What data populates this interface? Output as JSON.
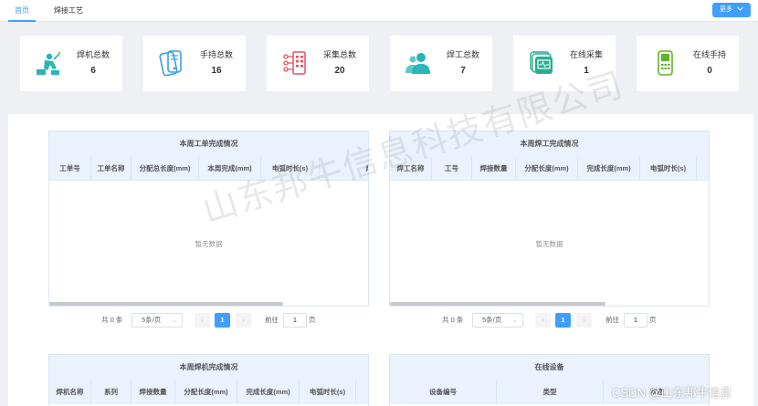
{
  "tabs": [
    {
      "label": "首页"
    },
    {
      "label": "焊接工艺"
    }
  ],
  "more_button": {
    "label": "更多",
    "icon": "chevron-down-icon"
  },
  "stats": [
    {
      "label": "焊机总数",
      "value": "6",
      "icon": "welder-icon",
      "color": "#2bb5b5"
    },
    {
      "label": "手持总数",
      "value": "16",
      "icon": "handheld-icon",
      "color": "#3aa0e0"
    },
    {
      "label": "采集总数",
      "value": "20",
      "icon": "collector-icon",
      "color": "#e35266"
    },
    {
      "label": "焊工总数",
      "value": "7",
      "icon": "users-icon",
      "color": "#2bb5b5"
    },
    {
      "label": "在线采集",
      "value": "1",
      "icon": "online-collector-icon",
      "color": "#27ae8f"
    },
    {
      "label": "在线手持",
      "value": "0",
      "icon": "online-handheld-icon",
      "color": "#5fb32a"
    }
  ],
  "panels": {
    "work_orders": {
      "title": "本周工单完成情况",
      "columns": [
        "工单号",
        "工单名称",
        "分配总长度(mm)",
        "本周完成(mm)",
        "电弧时长(s)",
        "焊丝消"
      ],
      "empty": "暂无数据",
      "pager": {
        "total": "共 0 条",
        "size": "5条/页",
        "page": "1",
        "goto": "前往",
        "goto_value": "1",
        "page_unit": "页"
      }
    },
    "welders": {
      "title": "本周焊工完成情况",
      "columns": [
        "焊工名称",
        "工号",
        "焊接数量",
        "分配长度(mm)",
        "完成长度(mm)",
        "电弧时长(s)"
      ],
      "empty": "暂无数据",
      "pager": {
        "total": "共 0 条",
        "size": "5条/页",
        "page": "1",
        "goto": "前往",
        "goto_value": "1",
        "page_unit": "页"
      }
    },
    "machines": {
      "title": "本周焊机完成情况",
      "columns": [
        "焊机名称",
        "系列",
        "焊接数量",
        "分配长度(mm)",
        "完成长度(mm)",
        "电弧时长(s)"
      ]
    },
    "online_devices": {
      "title": "在线设备",
      "columns": [
        "设备编号",
        "类型",
        "状态"
      ]
    }
  },
  "watermark": "山东邦牛信息科技有限公司",
  "footer_mark": "CSDN @山东邦牛信息"
}
